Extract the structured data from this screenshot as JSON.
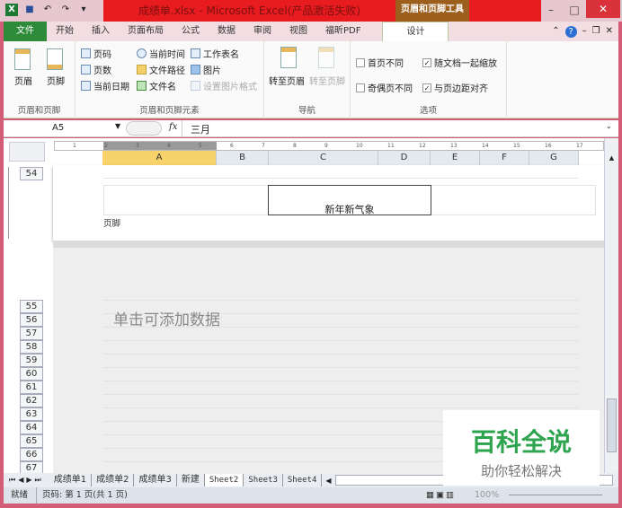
{
  "title": "成绩单.xlsx - Microsoft Excel(产品激活失败)",
  "context_tab": "页眉和页脚工具",
  "tabs": [
    "文件",
    "开始",
    "插入",
    "页面布局",
    "公式",
    "数据",
    "审阅",
    "视图",
    "福昕PDF",
    "设计"
  ],
  "ribbon": {
    "g1": {
      "label": "页眉和页脚",
      "header": "页眉",
      "footer": "页脚"
    },
    "g2": {
      "label": "页眉和页脚元素",
      "items": [
        "页码",
        "页数",
        "当前日期",
        "当前时间",
        "文件路径",
        "文件名",
        "工作表名",
        "图片",
        "设置图片格式"
      ]
    },
    "g3": {
      "label": "导航",
      "goto_header": "转至页眉",
      "goto_footer": "转至页脚"
    },
    "g4": {
      "label": "选项",
      "first": "首页不同",
      "oddeven": "奇偶页不同",
      "scale": "随文档一起缩放",
      "align": "与页边距对齐"
    }
  },
  "formula": {
    "namebox": "A5",
    "fx": "fx",
    "value": "三月"
  },
  "columns": [
    "A",
    "B",
    "C",
    "D",
    "E",
    "F",
    "G"
  ],
  "ruler": [
    "1",
    "2",
    "3",
    "4",
    "5",
    "6",
    "7",
    "8",
    "9",
    "10",
    "11",
    "12",
    "13",
    "14",
    "15",
    "16",
    "17"
  ],
  "row_top": "54",
  "footer_label": "页脚",
  "footer_center": "新年新气象",
  "placeholder": "单击可添加数据",
  "rows": [
    "55",
    "56",
    "57",
    "58",
    "59",
    "60",
    "61",
    "62",
    "63",
    "64",
    "65",
    "66",
    "67"
  ],
  "sheet_tabs": [
    "成绩单1",
    "成绩单2",
    "成绩单3",
    "新建",
    "Sheet2",
    "Sheet3",
    "Sheet4"
  ],
  "status": {
    "ready": "就绪",
    "page": "页码: 第 1 页(共 1 页)",
    "zoom": "100%"
  },
  "watermark": {
    "title": "百科全说",
    "subtitle": "助你轻松解决"
  }
}
